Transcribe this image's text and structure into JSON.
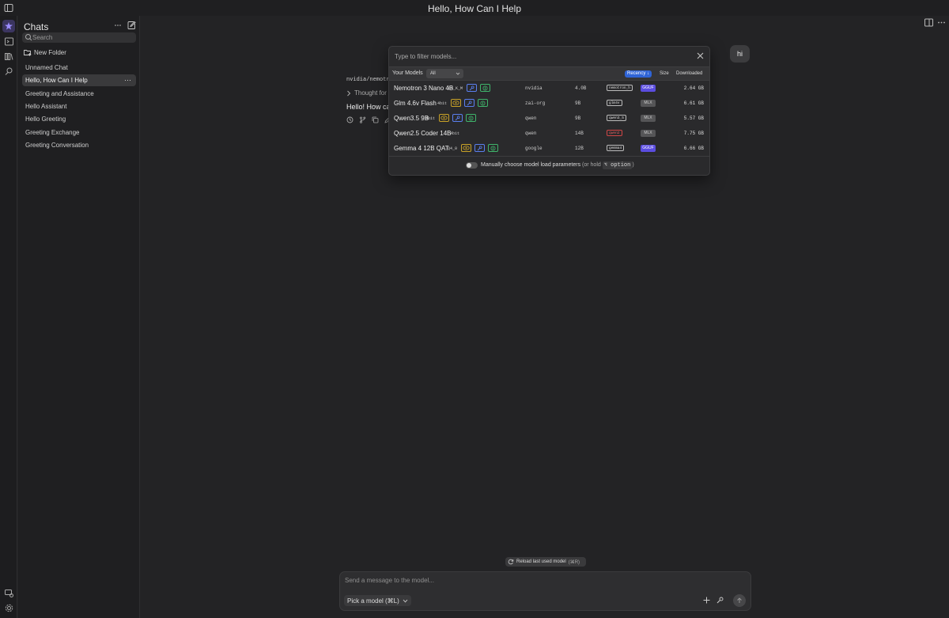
{
  "window": {
    "title": "Hello, How Can I Help"
  },
  "sidebar": {
    "title": "Chats",
    "search_placeholder": "Search",
    "new_folder_label": "New Folder",
    "chats": [
      {
        "label": "Unnamed Chat",
        "selected": false
      },
      {
        "label": "Hello, How Can I Help",
        "selected": true
      },
      {
        "label": "Greeting and Assistance",
        "selected": false
      },
      {
        "label": "Hello Assistant",
        "selected": false
      },
      {
        "label": "Hello Greeting",
        "selected": false
      },
      {
        "label": "Greeting Exchange",
        "selected": false
      },
      {
        "label": "Greeting Conversation",
        "selected": false
      }
    ]
  },
  "conversation": {
    "user_message": "hi",
    "model_id": "nvidia/nemotro",
    "thought_label": "Thought for",
    "reply_preview": "Hello! How can"
  },
  "picker": {
    "filter_placeholder": "Type to filter models...",
    "your_models_label": "Your Models",
    "filter_value": "All",
    "sort": {
      "recency": "Recency ↓",
      "size": "Size",
      "downloaded": "Downloaded",
      "active": "recency"
    },
    "models": [
      {
        "name": "Nemotron 3 Nano 4B",
        "quant": "Q4_K_M",
        "caps": [
          "tool",
          "reason"
        ],
        "publisher": "nvidia",
        "params": "4.0B",
        "arch": "nemotron_h",
        "arch_color": "#bbbbbb",
        "format": "GGUF",
        "size": "2.64 GB"
      },
      {
        "name": "Glm 4.6v Flash",
        "quant": "4bit",
        "caps": [
          "vision",
          "tool",
          "reason"
        ],
        "publisher": "zai-org",
        "params": "9B",
        "arch": "glm4v",
        "arch_color": "#bbbbbb",
        "format": "MLX",
        "size": "6.61 GB"
      },
      {
        "name": "Qwen3.5 9B",
        "quant": "4bit",
        "caps": [
          "vision",
          "tool",
          "reason"
        ],
        "publisher": "qwen",
        "params": "9B",
        "arch": "qwen3_5",
        "arch_color": "#bbbbbb",
        "format": "MLX",
        "size": "5.57 GB"
      },
      {
        "name": "Qwen2.5 Coder 14B",
        "quant": "4bit",
        "caps": [],
        "publisher": "qwen",
        "params": "14B",
        "arch": "qwen2",
        "arch_color": "#d14646",
        "format": "MLX",
        "size": "7.75 GB"
      },
      {
        "name": "Gemma 4 12B QAT",
        "quant": "Q4_0",
        "caps": [
          "vision",
          "tool",
          "reason"
        ],
        "publisher": "google",
        "params": "12B",
        "arch": "gemma4",
        "arch_color": "#bbbbbb",
        "format": "GGUF",
        "size": "6.66 GB"
      }
    ],
    "footer": {
      "label": "Manually choose model load parameters",
      "hint_prefix": "(or hold",
      "key": "⌥ option",
      "hint_suffix": ")"
    }
  },
  "composer": {
    "placeholder": "Send a message to the model...",
    "pick_model_label": "Pick a model (⌘L)",
    "reload_label": "Reload last used model",
    "reload_shortcut": "(⌘R)"
  },
  "colors": {
    "accent": "#2f64d6",
    "gguf": "#5b4de0",
    "vision": "#c9a227",
    "tool": "#5a7ff0",
    "reason": "#3fb56b"
  },
  "icons": [
    "sidebar-toggle-icon",
    "chat-icon",
    "terminal-icon",
    "library-icon",
    "search-models-icon",
    "more-icon",
    "compose-icon",
    "search-icon",
    "folder-plus-icon",
    "split-panel-icon",
    "chevron-right-icon",
    "clock-icon",
    "branch-icon",
    "copy-icon",
    "edit-icon",
    "close-icon",
    "chevron-down-icon",
    "refresh-icon",
    "plus-icon",
    "wrench-icon",
    "arrow-up-icon",
    "eye-icon",
    "hammer-icon",
    "brain-icon",
    "user-settings-icon",
    "gear-icon"
  ]
}
